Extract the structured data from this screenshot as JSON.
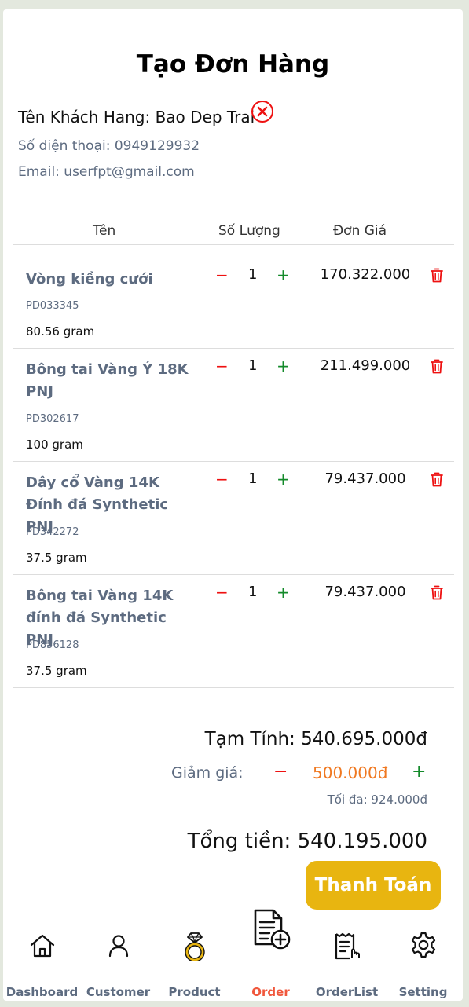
{
  "page": {
    "title": "Tạo Đơn Hàng"
  },
  "customer": {
    "name": "Tên Khách Hang: Bao Dep Trai",
    "phone": "Số điện thoại: 0949129932",
    "email": "Email: userfpt@gmail.com"
  },
  "table": {
    "headers": {
      "name": "Tên",
      "quantity": "Số Lượng",
      "price": "Đơn Giá"
    },
    "minus_label": "−",
    "plus_label": "+",
    "rows": [
      {
        "name": "Vòng kiềng cưới",
        "code": "PD033345",
        "weight": "80.56 gram",
        "qty": "1",
        "price": "170.322.000"
      },
      {
        "name": "Bông tai Vàng Ý 18K PNJ",
        "code": "PD302617",
        "weight": "100 gram",
        "qty": "1",
        "price": "211.499.000"
      },
      {
        "name": "Dây cổ Vàng 14K Đính đá Synthetic PNJ",
        "code": "PD342272",
        "weight": "37.5 gram",
        "qty": "1",
        "price": "79.437.000"
      },
      {
        "name": "Bông tai Vàng 14K đính đá Synthetic PNJ",
        "code": "PD856128",
        "weight": "37.5 gram",
        "qty": "1",
        "price": "79.437.000"
      }
    ]
  },
  "summary": {
    "subtotal": "Tạm Tính: 540.695.000đ",
    "discount_label": "Giảm giá:",
    "discount_value": "500.000đ",
    "discount_max": "Tối đa: 924.000đ",
    "total": "Tổng tiền: 540.195.000",
    "pay_button": "Thanh Toán"
  },
  "nav": {
    "items": [
      {
        "label": "Dashboard",
        "icon": "home-icon"
      },
      {
        "label": "Customer",
        "icon": "user-icon"
      },
      {
        "label": "Product",
        "icon": "ring-icon"
      },
      {
        "label": "Order",
        "icon": "order-add-icon",
        "active": true
      },
      {
        "label": "OrderList",
        "icon": "receipt-icon"
      },
      {
        "label": "Setting",
        "icon": "gear-icon"
      }
    ]
  },
  "colors": {
    "accent": "#e8b510",
    "active_nav": "#f0573c",
    "minus": "#e11111",
    "plus": "#138a2a",
    "discount": "#f07820",
    "muted": "#5d6b80"
  }
}
